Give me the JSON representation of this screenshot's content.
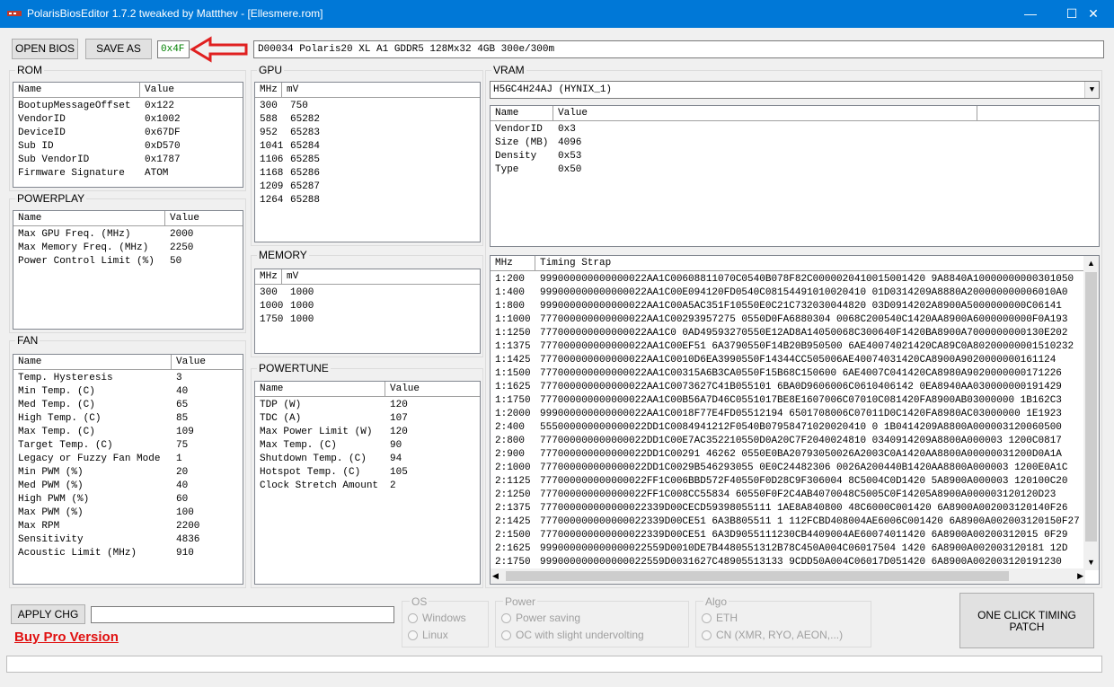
{
  "window": {
    "title": "PolarisBiosEditor 1.7.2 tweaked by Mattthev - [Ellesmere.rom]",
    "minimize": "—",
    "maximize": "☐",
    "close": "✕"
  },
  "toolbar": {
    "open_label": "OPEN BIOS",
    "save_label": "SAVE AS",
    "checksum": "0x4F",
    "bios_info": "D00034 Polaris20 XL A1 GDDR5 128Mx32 4GB 300e/300m"
  },
  "rom": {
    "title": "ROM",
    "headers": [
      "Name",
      "Value"
    ],
    "rows": [
      [
        "BootupMessageOffset",
        "0x122"
      ],
      [
        "VendorID",
        "0x1002"
      ],
      [
        "DeviceID",
        "0x67DF"
      ],
      [
        "Sub ID",
        "0xD570"
      ],
      [
        "Sub VendorID",
        "0x1787"
      ],
      [
        "Firmware Signature",
        "ATOM"
      ]
    ]
  },
  "powerplay": {
    "title": "POWERPLAY",
    "headers": [
      "Name",
      "Value"
    ],
    "rows": [
      [
        "Max GPU Freq. (MHz)",
        "2000"
      ],
      [
        "Max Memory Freq. (MHz)",
        "2250"
      ],
      [
        "Power Control Limit (%)",
        "50"
      ]
    ]
  },
  "fan": {
    "title": "FAN",
    "headers": [
      "Name",
      "Value"
    ],
    "rows": [
      [
        "Temp. Hysteresis",
        "3"
      ],
      [
        "Min Temp. (C)",
        "40"
      ],
      [
        "Med Temp. (C)",
        "65"
      ],
      [
        "High Temp. (C)",
        "85"
      ],
      [
        "Max Temp. (C)",
        "109"
      ],
      [
        "Target Temp. (C)",
        "75"
      ],
      [
        "Legacy or Fuzzy Fan Mode",
        "1"
      ],
      [
        "Min PWM (%)",
        "20"
      ],
      [
        "Med PWM (%)",
        "40"
      ],
      [
        "High PWM (%)",
        "60"
      ],
      [
        "Max PWM (%)",
        "100"
      ],
      [
        "Max RPM",
        "2200"
      ],
      [
        "Sensitivity",
        "4836"
      ],
      [
        "Acoustic Limit (MHz)",
        "910"
      ]
    ]
  },
  "gpu": {
    "title": "GPU",
    "headers": [
      "MHz",
      "mV"
    ],
    "rows": [
      [
        "300",
        "750"
      ],
      [
        "588",
        "65282"
      ],
      [
        "952",
        "65283"
      ],
      [
        "1041",
        "65284"
      ],
      [
        "1106",
        "65285"
      ],
      [
        "1168",
        "65286"
      ],
      [
        "1209",
        "65287"
      ],
      [
        "1264",
        "65288"
      ]
    ]
  },
  "memory": {
    "title": "MEMORY",
    "headers": [
      "MHz",
      "mV"
    ],
    "rows": [
      [
        "300",
        "1000"
      ],
      [
        "1000",
        "1000"
      ],
      [
        "1750",
        "1000"
      ]
    ]
  },
  "powertune": {
    "title": "POWERTUNE",
    "headers": [
      "Name",
      "Value"
    ],
    "rows": [
      [
        "TDP (W)",
        "120"
      ],
      [
        "TDC (A)",
        "107"
      ],
      [
        "Max Power Limit (W)",
        "120"
      ],
      [
        "Max Temp. (C)",
        "90"
      ],
      [
        "Shutdown Temp. (C)",
        "94"
      ],
      [
        "Hotspot Temp. (C)",
        "105"
      ],
      [
        "Clock Stretch Amount",
        "2"
      ]
    ]
  },
  "vram": {
    "title": "VRAM",
    "selected": "H5GC4H24AJ (HYNIX_1)",
    "headers": [
      "Name",
      "Value"
    ],
    "rows": [
      [
        "VendorID",
        "0x3"
      ],
      [
        "Size (MB)",
        "4096"
      ],
      [
        "Density",
        "0x53"
      ],
      [
        "Type",
        "0x50"
      ]
    ]
  },
  "timings": {
    "headers": [
      "MHz",
      "Timing Strap"
    ],
    "rows": [
      [
        "1:200",
        "999000000000000022AA1C00608811070C0540B078F82C0000020410015001420 9A8840A10000000000301050"
      ],
      [
        "1:400",
        "999000000000000022AA1C00E094120FD0540C08154491010020410 01D0314209A8880A200000000006010A0"
      ],
      [
        "1:800",
        "999000000000000022AA1C00A5AC351F10550E0C21C732030044820 03D0914202A8900A5000000000C06141"
      ],
      [
        "1:1000",
        "777000000000000022AA1C00293957275 0550D0FA6880304 0068C200540C1420AA8900A6000000000F0A193"
      ],
      [
        "1:1250",
        "777000000000000022AA1C0 0AD49593270550E12AD8A14050068C300640F1420BA8900A7000000000130E202"
      ],
      [
        "1:1375",
        "777000000000000022AA1C00EF51 6A3790550F14B20B950500 6AE40074021420CA89C0A80200000001510232"
      ],
      [
        "1:1425",
        "777000000000000022AA1C0010D6EA3990550F14344CC505006AE40074031420CA8900A9020000000161124"
      ],
      [
        "1:1500",
        "777000000000000022AA1C00315A6B3CA0550F15B68C150600 6AE4007C041420CA8980A9020000000171226"
      ],
      [
        "1:1625",
        "777000000000000022AA1C0073627C41B055101 6BA0D9606006C0610406142 0EA8940AA030000000191429"
      ],
      [
        "1:1750",
        "777000000000000022AA1C00B56A7D46C0551017BE8E1607006C07010C081420FA8900AB03000000 1B162C3"
      ],
      [
        "1:2000",
        "999000000000000022AA1C0018F77E4FD05512194 6501708006C07011D0C1420FA8980AC03000000 1E1923"
      ],
      [
        "2:400",
        "555000000000000022DD1C0084941212F0540B07958471020020410 0 1B0414209A8800A000003120060500"
      ],
      [
        "2:800",
        "777000000000000022DD1C00E7AC352210550D0A20C7F2040024810 0340914209A8800A000003 1200C0817"
      ],
      [
        "2:900",
        "777000000000000022DD1C00291 46262 0550E0BA20793050026A2003C0A1420AA8800A00000031200D0A1A"
      ],
      [
        "2:1000",
        "777000000000000022DD1C0029B546293055 0E0C24482306 0026A200440B1420AA8800A000003 1200E0A1C"
      ],
      [
        "2:1125",
        "777000000000000022FF1C006BBD572F40550F0D28C9F306004 8C5004C0D1420 5A8900A000003 120100C20"
      ],
      [
        "2:1250",
        "777000000000000022FF1C008CC55834 60550F0F2C4AB4070048C5005C0F14205A8900A000003120120D23"
      ],
      [
        "2:1375",
        "777000000000000022339D00CECD59398055111 1AE8A840800 48C6000C001420 6A8900A002003120140F26"
      ],
      [
        "2:1425",
        "777000000000000022339D00CE51 6A3B805511 1 112FCBD408004AE6006C001420 6A8900A002003120150F27"
      ],
      [
        "2:1500",
        "777000000000000022339D00CE51 6A3D9055111230CB4409004AE60074011420 6A8900A00200312015 0F29"
      ],
      [
        "2:1625",
        "999000000000000022559D0010DE7B4480551312B78C450A004C06017504 1420 6A8900A002003120181 12D"
      ],
      [
        "2:1750",
        "999000000000000022559D0031627C48905513133 9CDD50A004C06017D051420 6A8900A002003120191230"
      ]
    ]
  },
  "bottom": {
    "apply_label": "APPLY CHG",
    "buy_label": "Buy Pro Version",
    "os_title": "OS",
    "os_options": [
      "Windows",
      "Linux"
    ],
    "power_title": "Power",
    "power_options": [
      "Power saving",
      "OC with slight undervolting"
    ],
    "algo_title": "Algo",
    "algo_options": [
      "ETH",
      "CN (XMR, RYO, AEON,...)"
    ],
    "patch_label_1": "ONE CLICK TIMING",
    "patch_label_2": "PATCH"
  },
  "colors": {
    "titlebar": "#0078d7",
    "checksum_text": "#008000",
    "arrow": "#e02020",
    "buy_link": "#e01010"
  }
}
